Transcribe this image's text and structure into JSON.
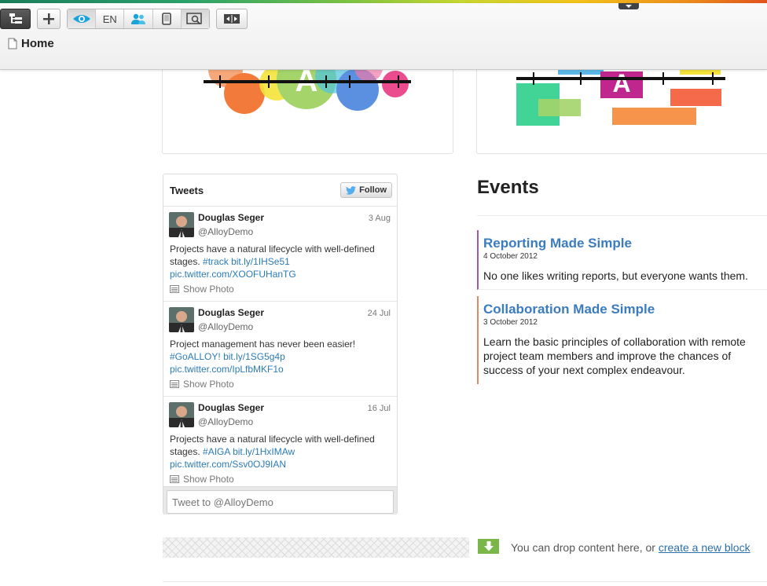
{
  "toolbar": {
    "buttons": [
      "tree-icon",
      "add-icon",
      "eye-icon",
      "users-icon",
      "mobile-icon",
      "preview-icon",
      "compare-icon"
    ],
    "language": "EN"
  },
  "breadcrumb": {
    "label": "Home"
  },
  "tweets": {
    "title": "Tweets",
    "follow_label": "Follow",
    "items": [
      {
        "name": "Douglas Seger",
        "handle": "@AlloyDemo",
        "date": "3 Aug",
        "text_before": "Projects have a natural lifecycle with well-defined stages.",
        "tag": "#track",
        "short_link": "bit.ly/1IHSe51",
        "pic": "pic.twitter.com/XOOFUHanTG",
        "photo_label": "Show Photo"
      },
      {
        "name": "Douglas Seger",
        "handle": "@AlloyDemo",
        "date": "24 Jul",
        "text_before": "Project management has never been easier!",
        "tag": "#GoALLOY!",
        "short_link": "bit.ly/1SG5g4p",
        "pic": "pic.twitter.com/IpLfbMKF1o",
        "photo_label": "Show Photo"
      },
      {
        "name": "Douglas Seger",
        "handle": "@AlloyDemo",
        "date": "16 Jul",
        "text_before": "Projects have a natural lifecycle with well-defined stages.",
        "tag": "#AIGA",
        "short_link": "bit.ly/1HxIMAw",
        "pic": "pic.twitter.com/Ssv0OJ9IAN",
        "photo_label": "Show Photo"
      }
    ],
    "input_placeholder": "Tweet to @AlloyDemo"
  },
  "events": {
    "title": "Events",
    "items": [
      {
        "title": "Reporting Made Simple",
        "date": "4 October 2012",
        "description": "No one likes writing reports, but everyone wants them.",
        "accent": "#9b59b6"
      },
      {
        "title": "Collaboration Made Simple",
        "date": "3 October 2012",
        "description": "Learn the basic principles of collaboration with remote project team members and improve the chances of success of your next complex endeavour.",
        "accent": "#e08a5c"
      }
    ]
  },
  "dropzone": {
    "text": "You can drop content here, or",
    "link": "create a new block"
  },
  "colors": {
    "link": "#2b7bb9",
    "event_title": "#3b7bbf",
    "drop_icon": "#7ab648"
  }
}
